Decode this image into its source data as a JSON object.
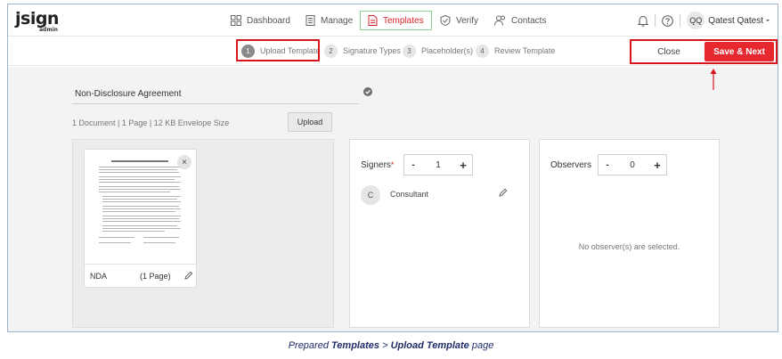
{
  "brand": {
    "logo_main": "jsign",
    "logo_sub": "admin"
  },
  "nav": {
    "dashboard": "Dashboard",
    "manage": "Manage",
    "templates": "Templates",
    "verify": "Verify",
    "contacts": "Contacts"
  },
  "user": {
    "initials": "QQ",
    "name": "Qatest Qatest"
  },
  "steps": [
    {
      "num": "1",
      "label": "Upload Template"
    },
    {
      "num": "2",
      "label": "Signature Types"
    },
    {
      "num": "3",
      "label": "Placeholder(s)"
    },
    {
      "num": "4",
      "label": "Review Template"
    }
  ],
  "actions": {
    "close": "Close",
    "save_next": "Save & Next"
  },
  "template": {
    "name": "Non-Disclosure Agreement",
    "info": "1 Document | 1 Page | 12 KB Envelope Size",
    "upload": "Upload"
  },
  "document": {
    "title": "NDA",
    "pages": "(1 Page)",
    "close_glyph": "×"
  },
  "signers": {
    "label": "Signers",
    "required_mark": "*",
    "count": "1",
    "minus": "-",
    "plus": "+",
    "items": [
      {
        "initial": "C",
        "name": "Consultant"
      }
    ]
  },
  "observers": {
    "label": "Observers",
    "count": "0",
    "minus": "-",
    "plus": "+",
    "empty": "No observer(s) are selected."
  },
  "caption": {
    "prefix": "Prepared ",
    "part1": "Templates",
    "sep": " > ",
    "part2": "Upload Template",
    "suffix": " page"
  },
  "colors": {
    "accent": "#e7282e",
    "highlight_box": "#d7141b",
    "templates_outline": "#8fcf8f",
    "caption": "#1f2d6b"
  }
}
